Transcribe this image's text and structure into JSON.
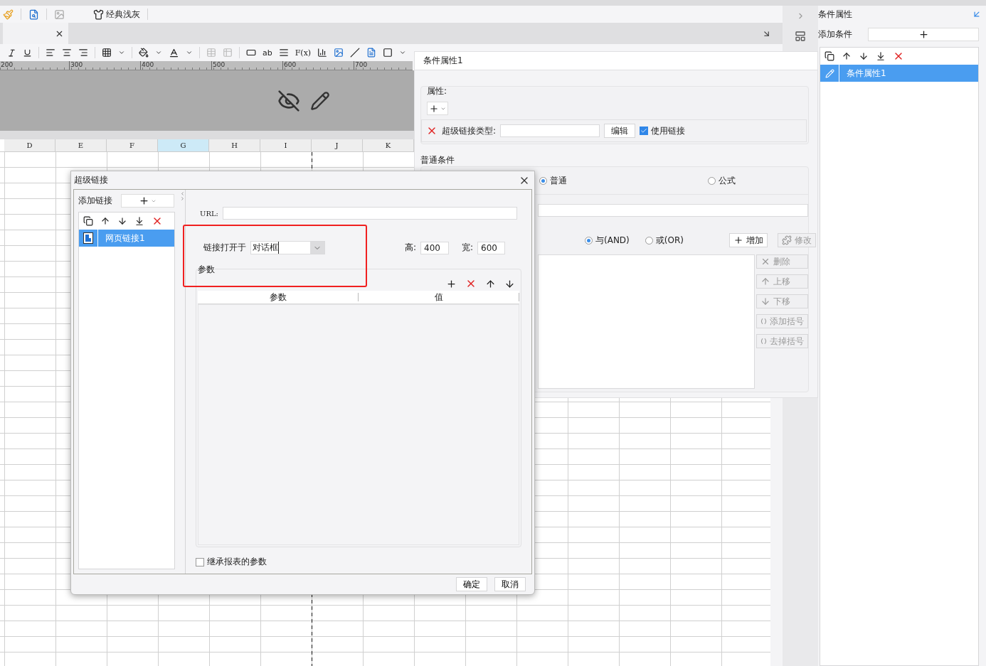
{
  "top_toolbar": {
    "theme_label": "经典浅灰"
  },
  "format_toolbar": {
    "text_button": "ab",
    "formula_button": "F(x)"
  },
  "ruler": {
    "labels": [
      "200",
      "300",
      "400",
      "500",
      "600",
      "700"
    ]
  },
  "sheet": {
    "columns": [
      {
        "label": "D",
        "selected": false
      },
      {
        "label": "E",
        "selected": false
      },
      {
        "label": "F",
        "selected": false
      },
      {
        "label": "G",
        "selected": true
      },
      {
        "label": "H",
        "selected": false
      },
      {
        "label": "I",
        "selected": false
      },
      {
        "label": "J",
        "selected": false
      },
      {
        "label": "K",
        "selected": false
      }
    ]
  },
  "right_panel": {
    "title": "条件属性",
    "add_label": "添加条件",
    "items": [
      {
        "label": "条件属性1",
        "selected": true
      }
    ]
  },
  "condition_window": {
    "title": "条件属性1",
    "properties_legend": "属性:",
    "hyperlink_type_label": "超级链接类型:",
    "edit_button": "编辑",
    "use_link": {
      "label": "使用链接",
      "checked": true
    },
    "normal_legend": "普通条件",
    "type_options": [
      {
        "label": "普通",
        "selected": true
      },
      {
        "label": "公式",
        "selected": false
      }
    ],
    "logic_options": [
      {
        "label": "与(AND)",
        "selected": true
      },
      {
        "label": "或(OR)",
        "selected": false
      }
    ],
    "actions": [
      {
        "label": "增加",
        "disabled": false
      },
      {
        "label": "修改",
        "disabled": true
      }
    ],
    "side_actions": [
      {
        "label": "删除",
        "disabled": true
      },
      {
        "label": "上移",
        "disabled": true
      },
      {
        "label": "下移",
        "disabled": true
      },
      {
        "label": "添加括号",
        "disabled": true
      },
      {
        "label": "去掉括号",
        "disabled": true
      }
    ]
  },
  "dialog": {
    "title": "超级链接",
    "add_label": "添加链接",
    "items": [
      {
        "label": "网页链接1",
        "selected": true
      }
    ],
    "url_label": "URL:",
    "open_in_label": "链接打开于",
    "open_in_value": "对话框",
    "height_label": "高:",
    "height_value": "400",
    "width_label": "宽:",
    "width_value": "600",
    "params_legend": "参数",
    "param_columns": [
      "参数",
      "值"
    ],
    "inherit": {
      "label": "继承报表的参数",
      "checked": false
    },
    "buttons": [
      "确定",
      "取消"
    ]
  }
}
